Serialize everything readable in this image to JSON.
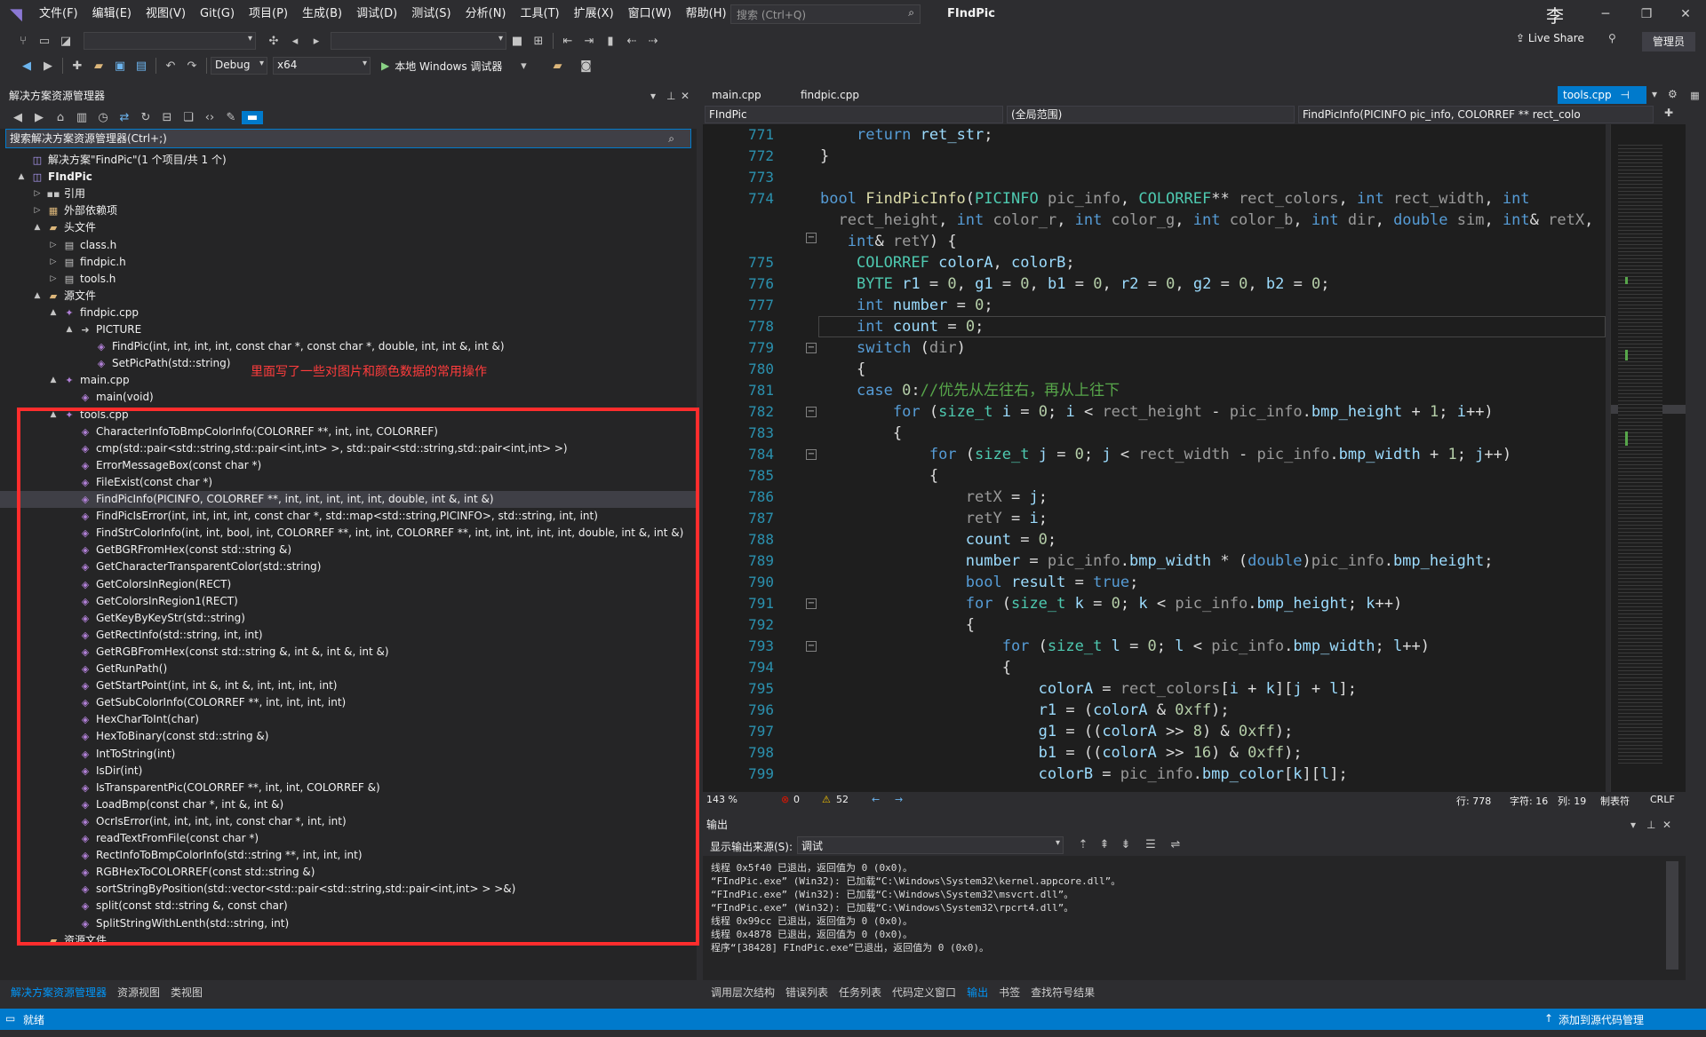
{
  "menu": {
    "items": [
      "文件(F)",
      "编辑(E)",
      "视图(V)",
      "Git(G)",
      "项目(P)",
      "生成(B)",
      "调试(D)",
      "测试(S)",
      "分析(N)",
      "工具(T)",
      "扩展(X)",
      "窗口(W)",
      "帮助(H)"
    ],
    "search_placeholder": "搜索 (Ctrl+Q)",
    "project_title": "FIndPic",
    "user_glyph": "李"
  },
  "toolbar": {
    "config": "Debug",
    "platform": "x64",
    "run_label": "本地 Windows 调试器",
    "live_share": "Live Share",
    "login": "管理员"
  },
  "solution_explorer": {
    "title": "解决方案资源管理器",
    "search": "搜索解决方案资源管理器(Ctrl+;)",
    "annotation": "里面写了一些对图片和颜色数据的常用操作",
    "tree": [
      {
        "label": "解决方案\"FindPic\"(1 个项目/共 1 个)",
        "level": 0,
        "arrow": "",
        "icon": "sln"
      },
      {
        "label": "FIndPic",
        "level": 0,
        "arrow": "▲",
        "icon": "proj",
        "bold": true
      },
      {
        "label": "引用",
        "level": 1,
        "arrow": "▷",
        "icon": "ref"
      },
      {
        "label": "外部依赖项",
        "level": 1,
        "arrow": "▷",
        "icon": "ext"
      },
      {
        "label": "头文件",
        "level": 1,
        "arrow": "▲",
        "icon": "folder"
      },
      {
        "label": "class.h",
        "level": 2,
        "arrow": "▷",
        "icon": "h"
      },
      {
        "label": "findpic.h",
        "level": 2,
        "arrow": "▷",
        "icon": "h"
      },
      {
        "label": "tools.h",
        "level": 2,
        "arrow": "▷",
        "icon": "h"
      },
      {
        "label": "源文件",
        "level": 1,
        "arrow": "▲",
        "icon": "folder"
      },
      {
        "label": "findpic.cpp",
        "level": 2,
        "arrow": "▲",
        "icon": "cpp"
      },
      {
        "label": "PICTURE",
        "level": 3,
        "arrow": "▲",
        "icon": "ns"
      },
      {
        "label": "FindPic(int, int, int, int, const char *, const char *, double, int, int &, int &)",
        "level": 4,
        "arrow": "",
        "icon": "fn"
      },
      {
        "label": "SetPicPath(std::string)",
        "level": 4,
        "arrow": "",
        "icon": "fn"
      },
      {
        "label": "main.cpp",
        "level": 2,
        "arrow": "▲",
        "icon": "cpp"
      },
      {
        "label": "main(void)",
        "level": 3,
        "arrow": "",
        "icon": "fn"
      },
      {
        "label": "tools.cpp",
        "level": 2,
        "arrow": "▲",
        "icon": "cpp"
      },
      {
        "label": "CharacterInfoToBmpColorInfo(COLORREF **, int, int, COLORREF)",
        "level": 3,
        "arrow": "",
        "icon": "fn"
      },
      {
        "label": "cmp(std::pair<std::string,std::pair<int,int> >, std::pair<std::string,std::pair<int,int> >)",
        "level": 3,
        "arrow": "",
        "icon": "fn"
      },
      {
        "label": "ErrorMessageBox(const char *)",
        "level": 3,
        "arrow": "",
        "icon": "fn"
      },
      {
        "label": "FileExist(const char *)",
        "level": 3,
        "arrow": "",
        "icon": "fn"
      },
      {
        "label": "FindPicInfo(PICINFO, COLORREF **, int, int, int, int, int, double, int &, int &)",
        "level": 3,
        "arrow": "",
        "icon": "fn",
        "selected": true
      },
      {
        "label": "FindPicIsError(int, int, int, int, const char *, std::map<std::string,PICINFO>, std::string, int, int)",
        "level": 3,
        "arrow": "",
        "icon": "fn"
      },
      {
        "label": "FindStrColorInfo(int, int, bool, int, COLORREF **, int, int, COLORREF **, int, int, int, int, int, double, int &, int &)",
        "level": 3,
        "arrow": "",
        "icon": "fn"
      },
      {
        "label": "GetBGRFromHex(const std::string &)",
        "level": 3,
        "arrow": "",
        "icon": "fn"
      },
      {
        "label": "GetCharacterTransparentColor(std::string)",
        "level": 3,
        "arrow": "",
        "icon": "fn"
      },
      {
        "label": "GetColorsInRegion(RECT)",
        "level": 3,
        "arrow": "",
        "icon": "fn"
      },
      {
        "label": "GetColorsInRegion1(RECT)",
        "level": 3,
        "arrow": "",
        "icon": "fn"
      },
      {
        "label": "GetKeyByKeyStr(std::string)",
        "level": 3,
        "arrow": "",
        "icon": "fn"
      },
      {
        "label": "GetRectInfo(std::string, int, int)",
        "level": 3,
        "arrow": "",
        "icon": "fn"
      },
      {
        "label": "GetRGBFromHex(const std::string &, int &, int &, int &)",
        "level": 3,
        "arrow": "",
        "icon": "fn"
      },
      {
        "label": "GetRunPath()",
        "level": 3,
        "arrow": "",
        "icon": "fn"
      },
      {
        "label": "GetStartPoint(int, int &, int &, int, int, int, int)",
        "level": 3,
        "arrow": "",
        "icon": "fn"
      },
      {
        "label": "GetSubColorInfo(COLORREF **, int, int, int, int)",
        "level": 3,
        "arrow": "",
        "icon": "fn"
      },
      {
        "label": "HexCharToInt(char)",
        "level": 3,
        "arrow": "",
        "icon": "fn"
      },
      {
        "label": "HexToBinary(const std::string &)",
        "level": 3,
        "arrow": "",
        "icon": "fn"
      },
      {
        "label": "IntToString(int)",
        "level": 3,
        "arrow": "",
        "icon": "fn"
      },
      {
        "label": "IsDir(int)",
        "level": 3,
        "arrow": "",
        "icon": "fn"
      },
      {
        "label": "IsTransparentPic(COLORREF **, int, int, COLORREF &)",
        "level": 3,
        "arrow": "",
        "icon": "fn"
      },
      {
        "label": "LoadBmp(const char *, int &, int &)",
        "level": 3,
        "arrow": "",
        "icon": "fn"
      },
      {
        "label": "OcrIsError(int, int, int, int, const char *, int, int)",
        "level": 3,
        "arrow": "",
        "icon": "fn"
      },
      {
        "label": "readTextFromFile(const char *)",
        "level": 3,
        "arrow": "",
        "icon": "fn"
      },
      {
        "label": "RectInfoToBmpColorInfo(std::string **, int, int, int)",
        "level": 3,
        "arrow": "",
        "icon": "fn"
      },
      {
        "label": "RGBHexToCOLORREF(const std::string &)",
        "level": 3,
        "arrow": "",
        "icon": "fn"
      },
      {
        "label": "sortStringByPosition(std::vector<std::pair<std::string,std::pair<int,int> > >&)",
        "level": 3,
        "arrow": "",
        "icon": "fn"
      },
      {
        "label": "split(const std::string &, const char)",
        "level": 3,
        "arrow": "",
        "icon": "fn"
      },
      {
        "label": "SplitStringWithLenth(std::string, int)",
        "level": 3,
        "arrow": "",
        "icon": "fn"
      },
      {
        "label": "资源文件",
        "level": 1,
        "arrow": "",
        "icon": "folder"
      }
    ],
    "bottom_tabs": [
      "解决方案资源管理器",
      "资源视图",
      "类视图"
    ]
  },
  "editor": {
    "tabs": [
      "main.cpp",
      "findpic.cpp",
      "tools.cpp"
    ],
    "nav": {
      "project": "FIndPic",
      "scope": "(全局范围)",
      "member": "FindPicInfo(PICINFO pic_info, COLORREF ** rect_colo"
    },
    "status": {
      "zoom": "143 %",
      "errors": "0",
      "warnings": "52",
      "line": "行: 778",
      "char": "字符: 16",
      "col": "列: 19",
      "indent": "制表符",
      "eol": "CRLF"
    }
  },
  "output": {
    "title": "输出",
    "source_label": "显示输出来源(S):",
    "source_value": "调试",
    "lines": [
      "线程 0x5f40 已退出，返回值为 0 (0x0)。",
      "“FIndPic.exe” (Win32): 已加载“C:\\Windows\\System32\\kernel.appcore.dll”。",
      "“FIndPic.exe” (Win32): 已加载“C:\\Windows\\System32\\msvcrt.dll”。",
      "“FIndPic.exe” (Win32): 已加载“C:\\Windows\\System32\\rpcrt4.dll”。",
      "线程 0x99cc 已退出，返回值为 0 (0x0)。",
      "线程 0x4878 已退出，返回值为 0 (0x0)。",
      "程序“[38428] FIndPic.exe”已退出，返回值为 0 (0x0)。"
    ],
    "bottom_tabs": [
      "调用层次结构",
      "错误列表",
      "任务列表",
      "代码定义窗口",
      "输出",
      "书签",
      "查找符号结果"
    ]
  },
  "statusbar": {
    "ready": "就绪",
    "source_control": "添加到源代码管理"
  },
  "colors": {
    "accent": "#007acc",
    "annotation": "#ff2d2d"
  }
}
